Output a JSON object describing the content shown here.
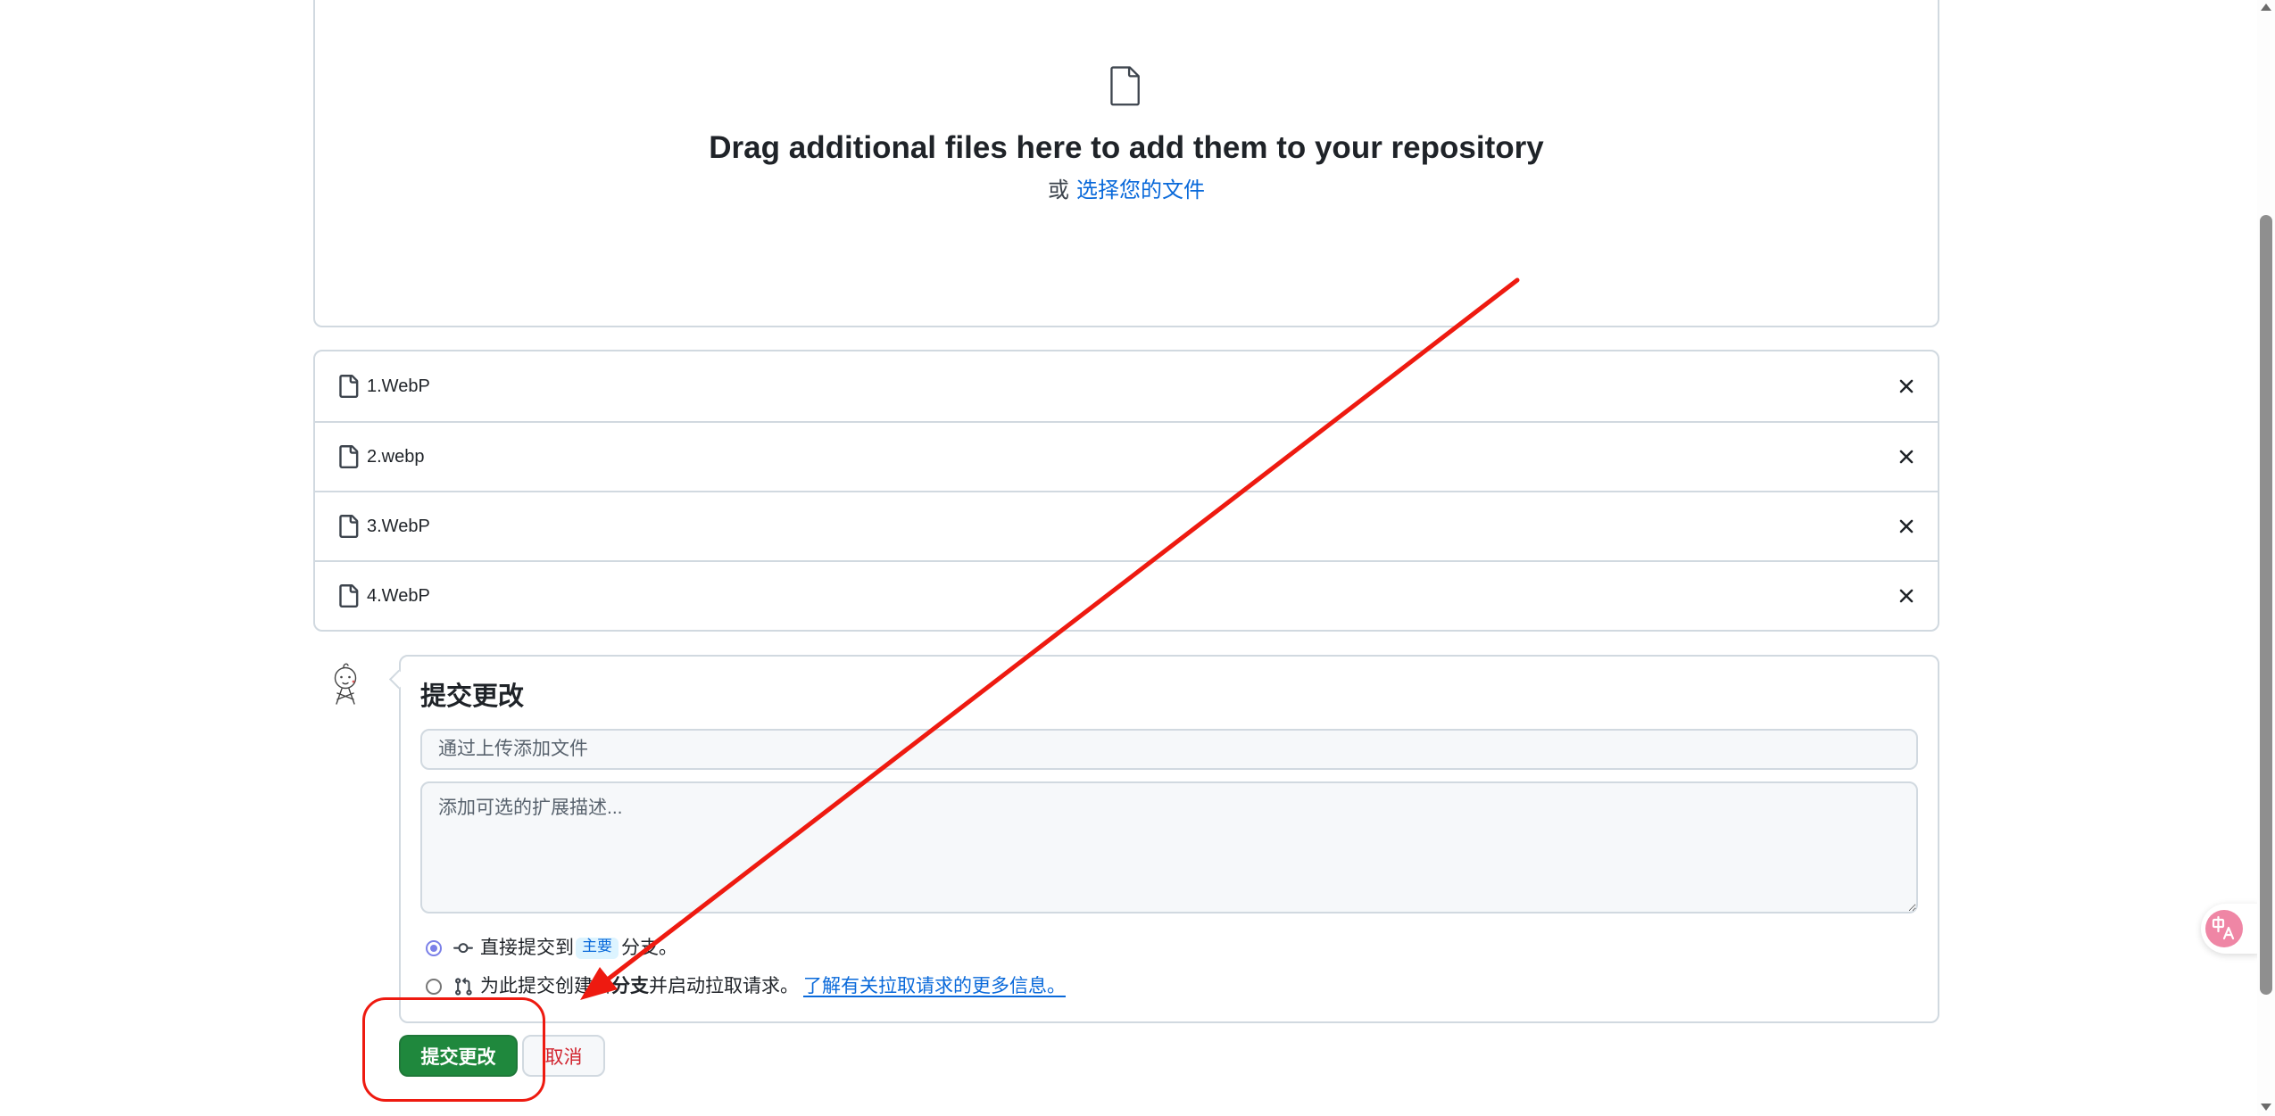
{
  "dropzone": {
    "icon": "file-icon",
    "heading": "Drag additional files here to add them to your repository",
    "or_text": "或",
    "choose_files_link": "选择您的文件"
  },
  "files": [
    {
      "name": "1.WebP",
      "icon": "file-icon",
      "remove_icon": "x-icon"
    },
    {
      "name": "2.webp",
      "icon": "file-icon",
      "remove_icon": "x-icon"
    },
    {
      "name": "3.WebP",
      "icon": "file-icon",
      "remove_icon": "x-icon"
    },
    {
      "name": "4.WebP",
      "icon": "file-icon",
      "remove_icon": "x-icon"
    }
  ],
  "commit": {
    "avatar_icon": "avatar-sketch-icon",
    "title": "提交更改",
    "summary": {
      "value": "",
      "placeholder": "通过上传添加文件"
    },
    "description": {
      "value": "",
      "placeholder": "添加可选的扩展描述..."
    },
    "options": [
      {
        "checked": true,
        "icon": "git-commit-icon",
        "text_before": "直接提交到",
        "branch": "主要",
        "text_after": "分支。"
      },
      {
        "checked": false,
        "icon": "git-pull-request-icon",
        "text_before": "为此提交创建新",
        "text_bold": "分支",
        "text_after": "并启动拉取请求。",
        "link": "了解有关拉取请求的更多信息。"
      }
    ],
    "submit_label": "提交更改",
    "cancel_label": "取消"
  },
  "widgets": {
    "translate_icon": "translate-icon"
  },
  "colors": {
    "accent_green": "#1f883d",
    "link_blue": "#0969da",
    "danger_red": "#d1242f",
    "annotation_red": "#ee1a10",
    "border": "#d1d9e0",
    "input_bg": "#f6f8fa",
    "branch_badge_bg": "#ddf4ff",
    "radio_accent": "#7b80e8",
    "translate_pink": "#ef86a5",
    "text": "#1f2328",
    "muted": "#59636e",
    "scroll_thumb": "#8f8f8f"
  }
}
